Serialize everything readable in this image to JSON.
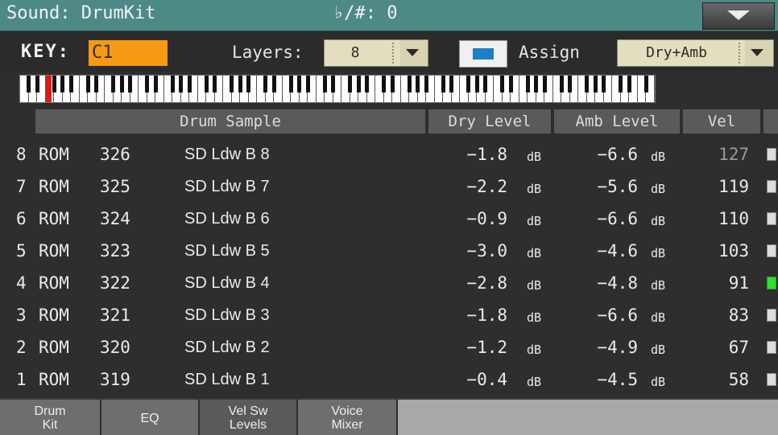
{
  "title_bar": {
    "title": "Sound: DrumKit",
    "transpose": "♭/#: 0"
  },
  "top": {
    "key_label": "KEY:",
    "key_value": "C1",
    "layers_label": "Layers:",
    "layers_value": "8",
    "assign_label": "Assign",
    "assign_checked": true,
    "mode_value": "Dry+Amb"
  },
  "keyboard": {
    "selected_key": "C1",
    "highlight_color": "#e01818"
  },
  "table": {
    "headers": {
      "sample": "Drum Sample",
      "dry": "Dry Level",
      "amb": "Amb Level",
      "vel": "Vel"
    },
    "rows": [
      {
        "layer": "8",
        "source": "ROM",
        "number": "326",
        "name": "SD Ldw B 8",
        "dry": "−1.8",
        "dry_unit": "dB",
        "amb": "−6.6",
        "amb_unit": "dB",
        "vel": "127",
        "active": false
      },
      {
        "layer": "7",
        "source": "ROM",
        "number": "325",
        "name": "SD Ldw B 7",
        "dry": "−2.2",
        "dry_unit": "dB",
        "amb": "−5.6",
        "amb_unit": "dB",
        "vel": "119",
        "active": false
      },
      {
        "layer": "6",
        "source": "ROM",
        "number": "324",
        "name": "SD Ldw B 6",
        "dry": "−0.9",
        "dry_unit": "dB",
        "amb": "−6.6",
        "amb_unit": "dB",
        "vel": "110",
        "active": false
      },
      {
        "layer": "5",
        "source": "ROM",
        "number": "323",
        "name": "SD Ldw B 5",
        "dry": "−3.0",
        "dry_unit": "dB",
        "amb": "−4.6",
        "amb_unit": "dB",
        "vel": "103",
        "active": false
      },
      {
        "layer": "4",
        "source": "ROM",
        "number": "322",
        "name": "SD Ldw B 4",
        "dry": "−2.8",
        "dry_unit": "dB",
        "amb": "−4.8",
        "amb_unit": "dB",
        "vel": "91",
        "active": true
      },
      {
        "layer": "3",
        "source": "ROM",
        "number": "321",
        "name": "SD Ldw B 3",
        "dry": "−1.8",
        "dry_unit": "dB",
        "amb": "−6.6",
        "amb_unit": "dB",
        "vel": "83",
        "active": false
      },
      {
        "layer": "2",
        "source": "ROM",
        "number": "320",
        "name": "SD Ldw B 2",
        "dry": "−1.2",
        "dry_unit": "dB",
        "amb": "−4.9",
        "amb_unit": "dB",
        "vel": "67",
        "active": false
      },
      {
        "layer": "1",
        "source": "ROM",
        "number": "319",
        "name": "SD Ldw B 1",
        "dry": "−0.4",
        "dry_unit": "dB",
        "amb": "−4.5",
        "amb_unit": "dB",
        "vel": "58",
        "active": false
      }
    ]
  },
  "tabs": [
    {
      "line1": "Drum",
      "line2": "Kit"
    },
    {
      "line1": "EQ",
      "line2": ""
    },
    {
      "line1": "Vel Sw",
      "line2": "Levels"
    },
    {
      "line1": "Voice",
      "line2": "Mixer"
    }
  ],
  "colors": {
    "title_bar": "#4d8a86",
    "key_field": "#f59a12",
    "active_indicator": "#2fe02f",
    "assign_check": "#1f7fc5"
  },
  "icons": {
    "menu": "triangle-down-icon",
    "dropdown": "chevron-down-icon"
  }
}
